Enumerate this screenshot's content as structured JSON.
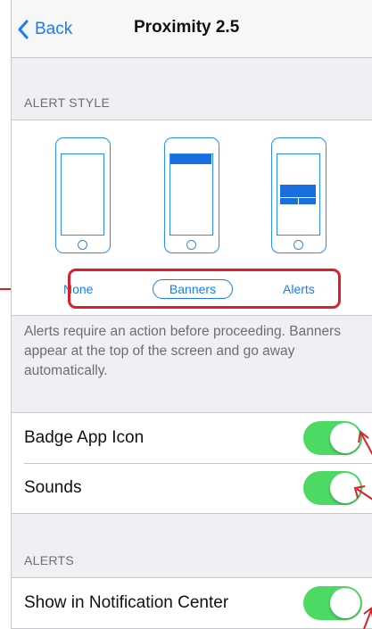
{
  "nav": {
    "back_label": "Back",
    "title": "Proximity 2.5"
  },
  "alert_style": {
    "header": "ALERT STYLE",
    "options": [
      {
        "label": "None",
        "selected": false
      },
      {
        "label": "Banners",
        "selected": true
      },
      {
        "label": "Alerts",
        "selected": false
      }
    ],
    "description": "Alerts require an action before proceeding. Banners appear at the top of the screen and go away automatically."
  },
  "settings": [
    {
      "label": "Badge App Icon",
      "on": true
    },
    {
      "label": "Sounds",
      "on": true
    }
  ],
  "alerts_section": {
    "header": "ALERTS",
    "rows": [
      {
        "label": "Show in Notification Center",
        "on": true
      }
    ]
  },
  "colors": {
    "ios_blue": "#1a7cf5",
    "toggle_green": "#4cd964",
    "annotation_red": "#d9202b",
    "group_background": "#efeff4"
  },
  "icons": {
    "back": "chevron-left-icon",
    "phone": "phone-outline-icon"
  }
}
